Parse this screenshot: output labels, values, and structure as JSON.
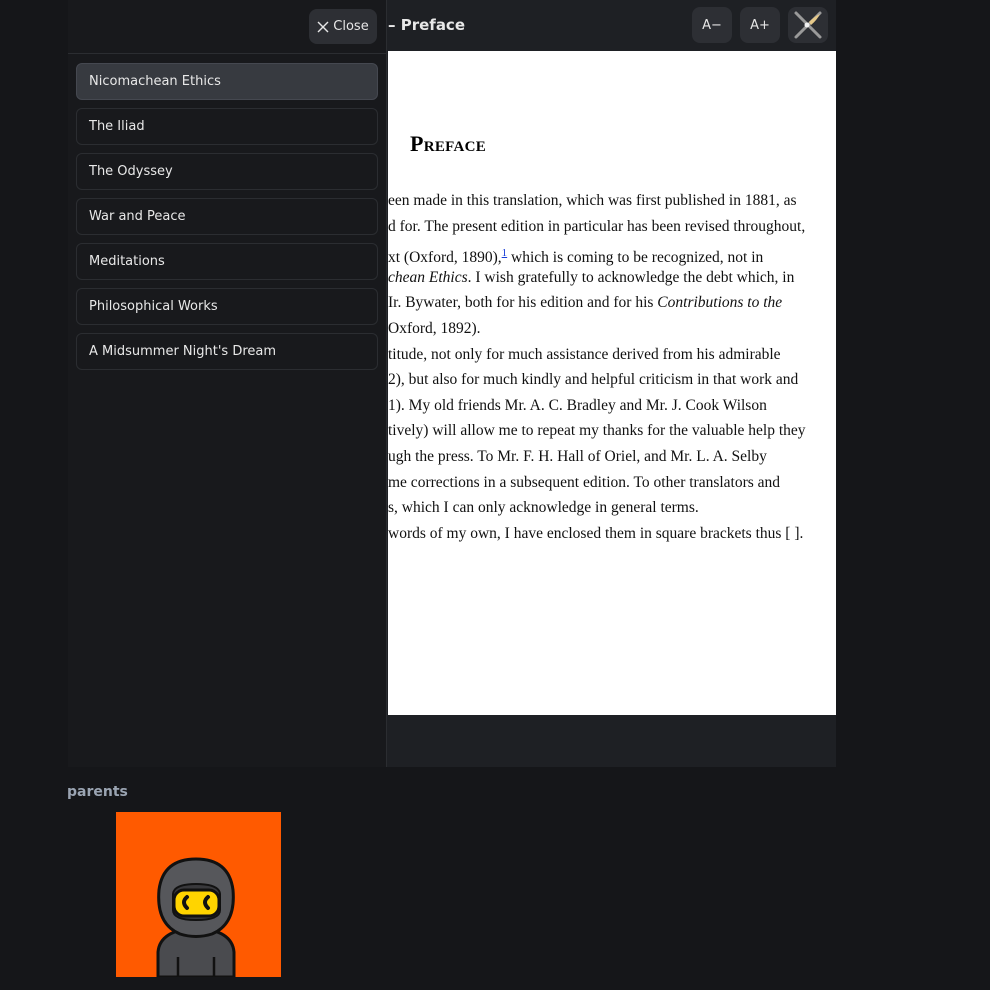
{
  "reader": {
    "chapter_title": "– Preface",
    "font_decrease_label": "A−",
    "font_increase_label": "A+",
    "theme_icon": "theme-toggle-icon",
    "page": {
      "heading": "Preface",
      "lines": [
        {
          "pre": "een made in this translation, which was first published in 1881, as"
        },
        {
          "pre": "d for. The present edition in particular has been revised throughout,"
        },
        {
          "pre": "xt (Oxford, 1890),",
          "sup": "1",
          "post": " which is coming to be recognized, not in"
        },
        {
          "pre": "",
          "em": "chean Ethics",
          "post": ". I wish gratefully to acknowledge the debt which, in"
        },
        {
          "pre": "Ir. Bywater, both for his edition and for his ",
          "em": "Contributions to the",
          "post": ""
        },
        {
          "pre": "Oxford, 1892)."
        },
        {
          "pre": "titude, not only for much assistance derived from his admirable"
        },
        {
          "pre": "2), but also for much kindly and helpful criticism in that work and"
        },
        {
          "pre": "1). My old friends Mr. A. C. Bradley and Mr. J. Cook Wilson"
        },
        {
          "pre": "tively) will allow me to repeat my thanks for the valuable help they"
        },
        {
          "pre": "ugh the press. To Mr. F. H. Hall of Oriel, and Mr. L. A. Selby"
        },
        {
          "pre": "me corrections in a subsequent edition. To other translators and"
        },
        {
          "pre": "s, which I can only acknowledge in general terms."
        },
        {
          "pre": "words of my own, I have enclosed them in square brackets thus [ ]."
        }
      ]
    }
  },
  "sidebar": {
    "close_label": "Close",
    "books": [
      {
        "label": "Nicomachean Ethics",
        "active": true
      },
      {
        "label": "The Iliad",
        "active": false
      },
      {
        "label": "The Odyssey",
        "active": false
      },
      {
        "label": "War and Peace",
        "active": false
      },
      {
        "label": "Meditations",
        "active": false
      },
      {
        "label": "Philosophical Works",
        "active": false
      },
      {
        "label": "A Midsummer Night's Dream",
        "active": false
      }
    ]
  },
  "parents": {
    "label": "parents",
    "avatar_bg": "#ff5a00"
  }
}
